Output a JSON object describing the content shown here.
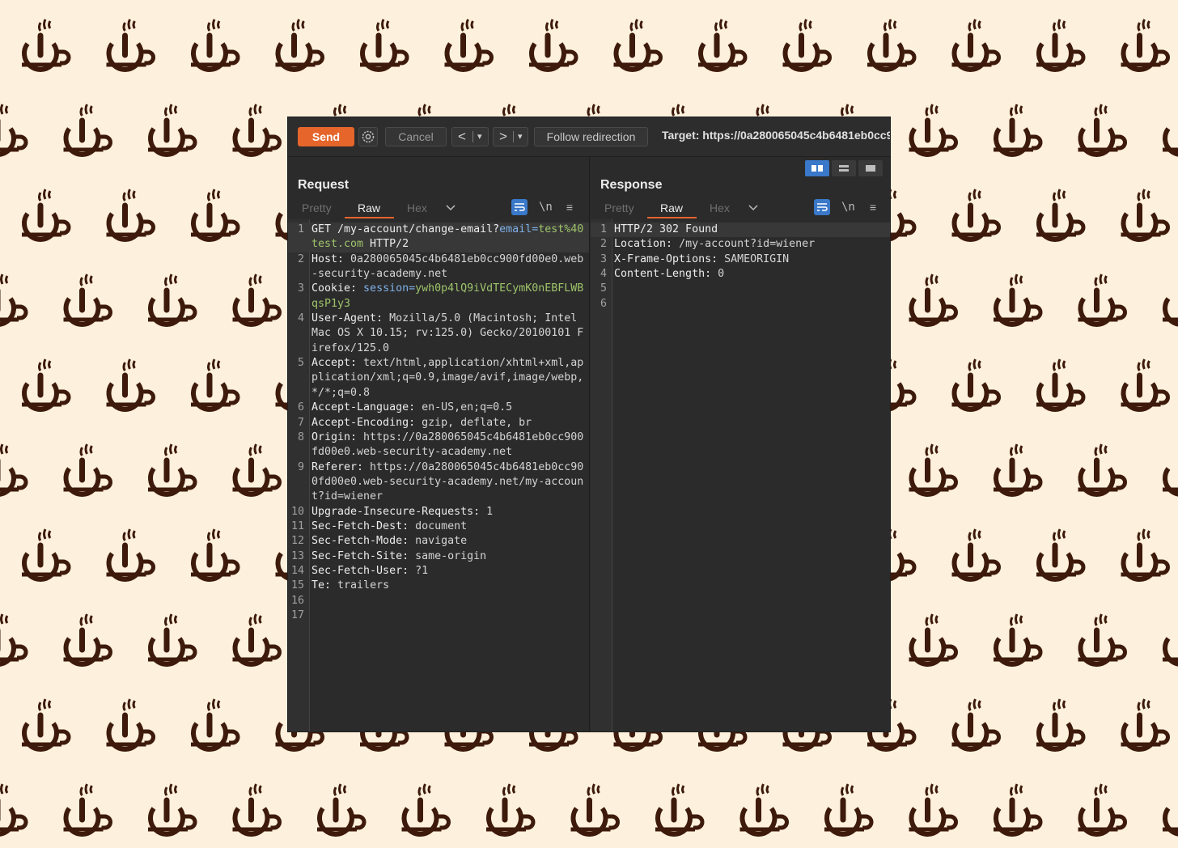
{
  "toolbar": {
    "send_label": "Send",
    "cancel_label": "Cancel",
    "back_label": "<",
    "forward_label": ">",
    "dropdown_glyph": "▾",
    "follow_label": "Follow redirection",
    "target_label": "Target: https://0a280065045c4b6481eb0cc9",
    "send_color": "#e5652b"
  },
  "request": {
    "title": "Request",
    "tabs": [
      {
        "label": "Pretty",
        "active": false
      },
      {
        "label": "Raw",
        "active": true
      },
      {
        "label": "Hex",
        "active": false
      }
    ],
    "newline_toggle": "\\n",
    "menu_icon": "≡",
    "lines": [
      {
        "n": "1",
        "parts": [
          {
            "t": "GET /my-account/change-email?",
            "c": "hname"
          },
          {
            "t": "email=",
            "c": "kv"
          },
          {
            "t": "test%40test.com",
            "c": "vv"
          },
          {
            "t": " HTTP/2",
            "c": "hname"
          }
        ],
        "highlight": true
      },
      {
        "n": "2",
        "parts": [
          {
            "t": "Host:",
            "c": "hname"
          },
          {
            "t": " 0a280065045c4b6481eb0cc900fd00e0.web-security-academy.net",
            "c": ""
          }
        ]
      },
      {
        "n": "3",
        "parts": [
          {
            "t": "Cookie:",
            "c": "hname"
          },
          {
            "t": " session=",
            "c": "kv"
          },
          {
            "t": "ywh0p4lQ9iVdTECymK0nEBFLWBqsP1y3",
            "c": "vv"
          }
        ]
      },
      {
        "n": "4",
        "parts": [
          {
            "t": "User-Agent:",
            "c": "hname"
          },
          {
            "t": " Mozilla/5.0 (Macintosh; Intel Mac OS X 10.15; rv:125.0) Gecko/20100101 Firefox/125.0",
            "c": ""
          }
        ]
      },
      {
        "n": "5",
        "parts": [
          {
            "t": "Accept:",
            "c": "hname"
          },
          {
            "t": " text/html,application/xhtml+xml,application/xml;q=0.9,image/avif,image/webp,*/*;q=0.8",
            "c": ""
          }
        ]
      },
      {
        "n": "6",
        "parts": [
          {
            "t": "Accept-Language:",
            "c": "hname"
          },
          {
            "t": " en-US,en;q=0.5",
            "c": ""
          }
        ]
      },
      {
        "n": "7",
        "parts": [
          {
            "t": "Accept-Encoding:",
            "c": "hname"
          },
          {
            "t": " gzip, deflate, br",
            "c": ""
          }
        ]
      },
      {
        "n": "8",
        "parts": [
          {
            "t": "Origin:",
            "c": "hname"
          },
          {
            "t": " https://0a280065045c4b6481eb0cc900fd00e0.web-security-academy.net",
            "c": ""
          }
        ]
      },
      {
        "n": "9",
        "parts": [
          {
            "t": "Referer:",
            "c": "hname"
          },
          {
            "t": " https://0a280065045c4b6481eb0cc900fd00e0.web-security-academy.net/my-account?id=wiener",
            "c": ""
          }
        ]
      },
      {
        "n": "10",
        "parts": [
          {
            "t": "Upgrade-Insecure-Requests:",
            "c": "hname"
          },
          {
            "t": " 1",
            "c": ""
          }
        ]
      },
      {
        "n": "11",
        "parts": [
          {
            "t": "Sec-Fetch-Dest:",
            "c": "hname"
          },
          {
            "t": " document",
            "c": ""
          }
        ]
      },
      {
        "n": "12",
        "parts": [
          {
            "t": "Sec-Fetch-Mode:",
            "c": "hname"
          },
          {
            "t": " navigate",
            "c": ""
          }
        ]
      },
      {
        "n": "13",
        "parts": [
          {
            "t": "Sec-Fetch-Site:",
            "c": "hname"
          },
          {
            "t": " same-origin",
            "c": ""
          }
        ]
      },
      {
        "n": "14",
        "parts": [
          {
            "t": "Sec-Fetch-User:",
            "c": "hname"
          },
          {
            "t": " ?1",
            "c": ""
          }
        ]
      },
      {
        "n": "15",
        "parts": [
          {
            "t": "Te:",
            "c": "hname"
          },
          {
            "t": " trailers",
            "c": ""
          }
        ]
      },
      {
        "n": "16",
        "parts": []
      },
      {
        "n": "17",
        "parts": []
      }
    ]
  },
  "response": {
    "title": "Response",
    "tabs": [
      {
        "label": "Pretty",
        "active": false
      },
      {
        "label": "Raw",
        "active": true
      },
      {
        "label": "Hex",
        "active": false
      }
    ],
    "newline_toggle": "\\n",
    "menu_icon": "≡",
    "lines": [
      {
        "n": "1",
        "parts": [
          {
            "t": "HTTP/2 302 Found",
            "c": "hname"
          }
        ],
        "highlight": true
      },
      {
        "n": "2",
        "parts": [
          {
            "t": "Location:",
            "c": "hname"
          },
          {
            "t": " /my-account?id=wiener",
            "c": ""
          }
        ]
      },
      {
        "n": "3",
        "parts": [
          {
            "t": "X-Frame-Options:",
            "c": "hname"
          },
          {
            "t": " SAMEORIGIN",
            "c": ""
          }
        ]
      },
      {
        "n": "4",
        "parts": [
          {
            "t": "Content-Length:",
            "c": "hname"
          },
          {
            "t": " 0",
            "c": ""
          }
        ]
      },
      {
        "n": "5",
        "parts": []
      },
      {
        "n": "6",
        "parts": []
      }
    ]
  },
  "background": {
    "color": "#fdf0dc",
    "icon": "coffee-cup-power-icon",
    "icon_color": "#3d1a0b"
  }
}
